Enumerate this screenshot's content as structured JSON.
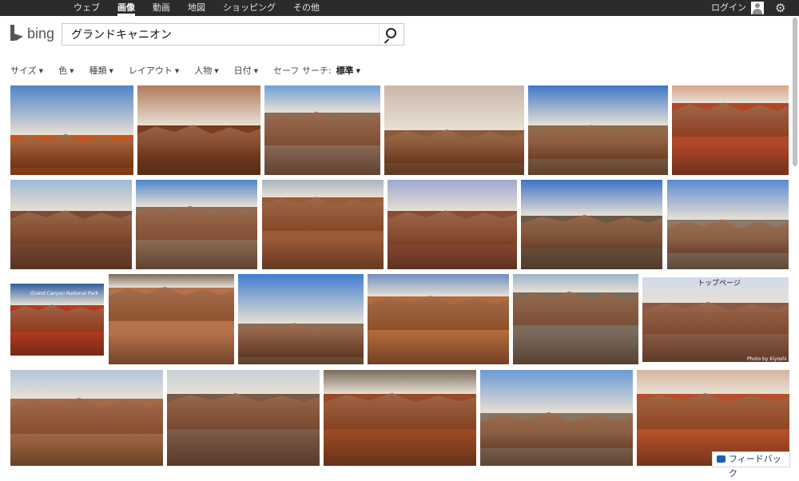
{
  "topnav": {
    "items": [
      "ウェブ",
      "画像",
      "動画",
      "地図",
      "ショッピング",
      "その他"
    ],
    "active_index": 1,
    "login_label": "ログイン"
  },
  "icons": {
    "avatar": "user-icon",
    "settings": "gear-icon",
    "search": "search-icon"
  },
  "logo": {
    "text": "bing"
  },
  "search": {
    "query": "グランドキャニオン"
  },
  "filters": {
    "items": [
      "サイズ",
      "色",
      "種類",
      "レイアウト",
      "人物",
      "日付"
    ],
    "safe_search_label": "セーフ サーチ:",
    "safe_search_value": "標準"
  },
  "image_overlays": {
    "card_title": "Grand Canyon National Park",
    "top_page_text": "トップページ",
    "photo_credit": "Photo by Kiyoshi"
  },
  "feedback": {
    "label": "フィードバック"
  },
  "colors": {
    "topbar": "#2b2b2b",
    "brand_gray": "#555555",
    "accent_blue": "#1a5fb4"
  }
}
